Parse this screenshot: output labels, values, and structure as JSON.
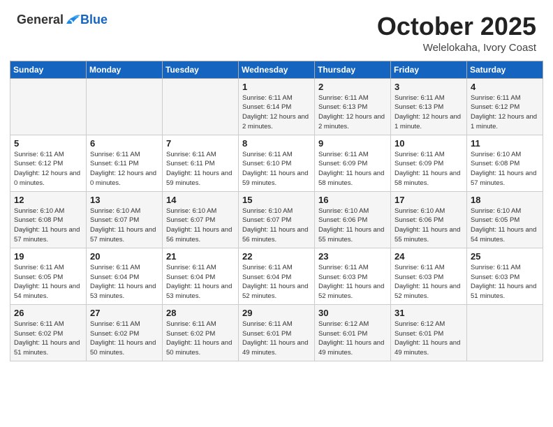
{
  "header": {
    "logo_general": "General",
    "logo_blue": "Blue",
    "month_year": "October 2025",
    "location": "Welelokaha, Ivory Coast"
  },
  "days_of_week": [
    "Sunday",
    "Monday",
    "Tuesday",
    "Wednesday",
    "Thursday",
    "Friday",
    "Saturday"
  ],
  "weeks": [
    [
      {
        "num": "",
        "info": ""
      },
      {
        "num": "",
        "info": ""
      },
      {
        "num": "",
        "info": ""
      },
      {
        "num": "1",
        "info": "Sunrise: 6:11 AM\nSunset: 6:14 PM\nDaylight: 12 hours and 2 minutes."
      },
      {
        "num": "2",
        "info": "Sunrise: 6:11 AM\nSunset: 6:13 PM\nDaylight: 12 hours and 2 minutes."
      },
      {
        "num": "3",
        "info": "Sunrise: 6:11 AM\nSunset: 6:13 PM\nDaylight: 12 hours and 1 minute."
      },
      {
        "num": "4",
        "info": "Sunrise: 6:11 AM\nSunset: 6:12 PM\nDaylight: 12 hours and 1 minute."
      }
    ],
    [
      {
        "num": "5",
        "info": "Sunrise: 6:11 AM\nSunset: 6:12 PM\nDaylight: 12 hours and 0 minutes."
      },
      {
        "num": "6",
        "info": "Sunrise: 6:11 AM\nSunset: 6:11 PM\nDaylight: 12 hours and 0 minutes."
      },
      {
        "num": "7",
        "info": "Sunrise: 6:11 AM\nSunset: 6:11 PM\nDaylight: 11 hours and 59 minutes."
      },
      {
        "num": "8",
        "info": "Sunrise: 6:11 AM\nSunset: 6:10 PM\nDaylight: 11 hours and 59 minutes."
      },
      {
        "num": "9",
        "info": "Sunrise: 6:11 AM\nSunset: 6:09 PM\nDaylight: 11 hours and 58 minutes."
      },
      {
        "num": "10",
        "info": "Sunrise: 6:11 AM\nSunset: 6:09 PM\nDaylight: 11 hours and 58 minutes."
      },
      {
        "num": "11",
        "info": "Sunrise: 6:10 AM\nSunset: 6:08 PM\nDaylight: 11 hours and 57 minutes."
      }
    ],
    [
      {
        "num": "12",
        "info": "Sunrise: 6:10 AM\nSunset: 6:08 PM\nDaylight: 11 hours and 57 minutes."
      },
      {
        "num": "13",
        "info": "Sunrise: 6:10 AM\nSunset: 6:07 PM\nDaylight: 11 hours and 57 minutes."
      },
      {
        "num": "14",
        "info": "Sunrise: 6:10 AM\nSunset: 6:07 PM\nDaylight: 11 hours and 56 minutes."
      },
      {
        "num": "15",
        "info": "Sunrise: 6:10 AM\nSunset: 6:07 PM\nDaylight: 11 hours and 56 minutes."
      },
      {
        "num": "16",
        "info": "Sunrise: 6:10 AM\nSunset: 6:06 PM\nDaylight: 11 hours and 55 minutes."
      },
      {
        "num": "17",
        "info": "Sunrise: 6:10 AM\nSunset: 6:06 PM\nDaylight: 11 hours and 55 minutes."
      },
      {
        "num": "18",
        "info": "Sunrise: 6:10 AM\nSunset: 6:05 PM\nDaylight: 11 hours and 54 minutes."
      }
    ],
    [
      {
        "num": "19",
        "info": "Sunrise: 6:11 AM\nSunset: 6:05 PM\nDaylight: 11 hours and 54 minutes."
      },
      {
        "num": "20",
        "info": "Sunrise: 6:11 AM\nSunset: 6:04 PM\nDaylight: 11 hours and 53 minutes."
      },
      {
        "num": "21",
        "info": "Sunrise: 6:11 AM\nSunset: 6:04 PM\nDaylight: 11 hours and 53 minutes."
      },
      {
        "num": "22",
        "info": "Sunrise: 6:11 AM\nSunset: 6:04 PM\nDaylight: 11 hours and 52 minutes."
      },
      {
        "num": "23",
        "info": "Sunrise: 6:11 AM\nSunset: 6:03 PM\nDaylight: 11 hours and 52 minutes."
      },
      {
        "num": "24",
        "info": "Sunrise: 6:11 AM\nSunset: 6:03 PM\nDaylight: 11 hours and 52 minutes."
      },
      {
        "num": "25",
        "info": "Sunrise: 6:11 AM\nSunset: 6:03 PM\nDaylight: 11 hours and 51 minutes."
      }
    ],
    [
      {
        "num": "26",
        "info": "Sunrise: 6:11 AM\nSunset: 6:02 PM\nDaylight: 11 hours and 51 minutes."
      },
      {
        "num": "27",
        "info": "Sunrise: 6:11 AM\nSunset: 6:02 PM\nDaylight: 11 hours and 50 minutes."
      },
      {
        "num": "28",
        "info": "Sunrise: 6:11 AM\nSunset: 6:02 PM\nDaylight: 11 hours and 50 minutes."
      },
      {
        "num": "29",
        "info": "Sunrise: 6:11 AM\nSunset: 6:01 PM\nDaylight: 11 hours and 49 minutes."
      },
      {
        "num": "30",
        "info": "Sunrise: 6:12 AM\nSunset: 6:01 PM\nDaylight: 11 hours and 49 minutes."
      },
      {
        "num": "31",
        "info": "Sunrise: 6:12 AM\nSunset: 6:01 PM\nDaylight: 11 hours and 49 minutes."
      },
      {
        "num": "",
        "info": ""
      }
    ]
  ]
}
